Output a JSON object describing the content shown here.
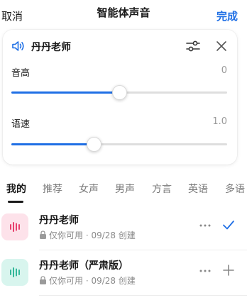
{
  "header": {
    "cancel_label": "取消",
    "title": "智能体声音",
    "done_label": "完成"
  },
  "voice_card": {
    "voice_name": "丹丹老师",
    "pitch": {
      "label": "音高",
      "value": "0",
      "position": 0.5
    },
    "speed": {
      "label": "语速",
      "value": "1.0",
      "position": 0.38
    }
  },
  "tabs": [
    {
      "label": "我的",
      "active": true
    },
    {
      "label": "推荐",
      "active": false
    },
    {
      "label": "女声",
      "active": false
    },
    {
      "label": "男声",
      "active": false
    },
    {
      "label": "方言",
      "active": false
    },
    {
      "label": "英语",
      "active": false
    },
    {
      "label": "多语",
      "active": false
    }
  ],
  "voices": [
    {
      "name": "丹丹老师",
      "visibility": "仅你可用",
      "created": "· 09/28 创建",
      "selected": true,
      "avatar_bg": "#fde2ea",
      "avatar_fg": "#e8416e",
      "icon": "check-icon"
    },
    {
      "name": "丹丹老师（严肃版）",
      "visibility": "仅你可用",
      "created": "· 09/28 创建",
      "selected": false,
      "avatar_bg": "#d8f5ee",
      "avatar_fg": "#33b89a",
      "icon": "plus-icon"
    }
  ],
  "colors": {
    "accent": "#1f6fe5",
    "text": "#1a1a1a",
    "muted": "#8a8a8a"
  }
}
